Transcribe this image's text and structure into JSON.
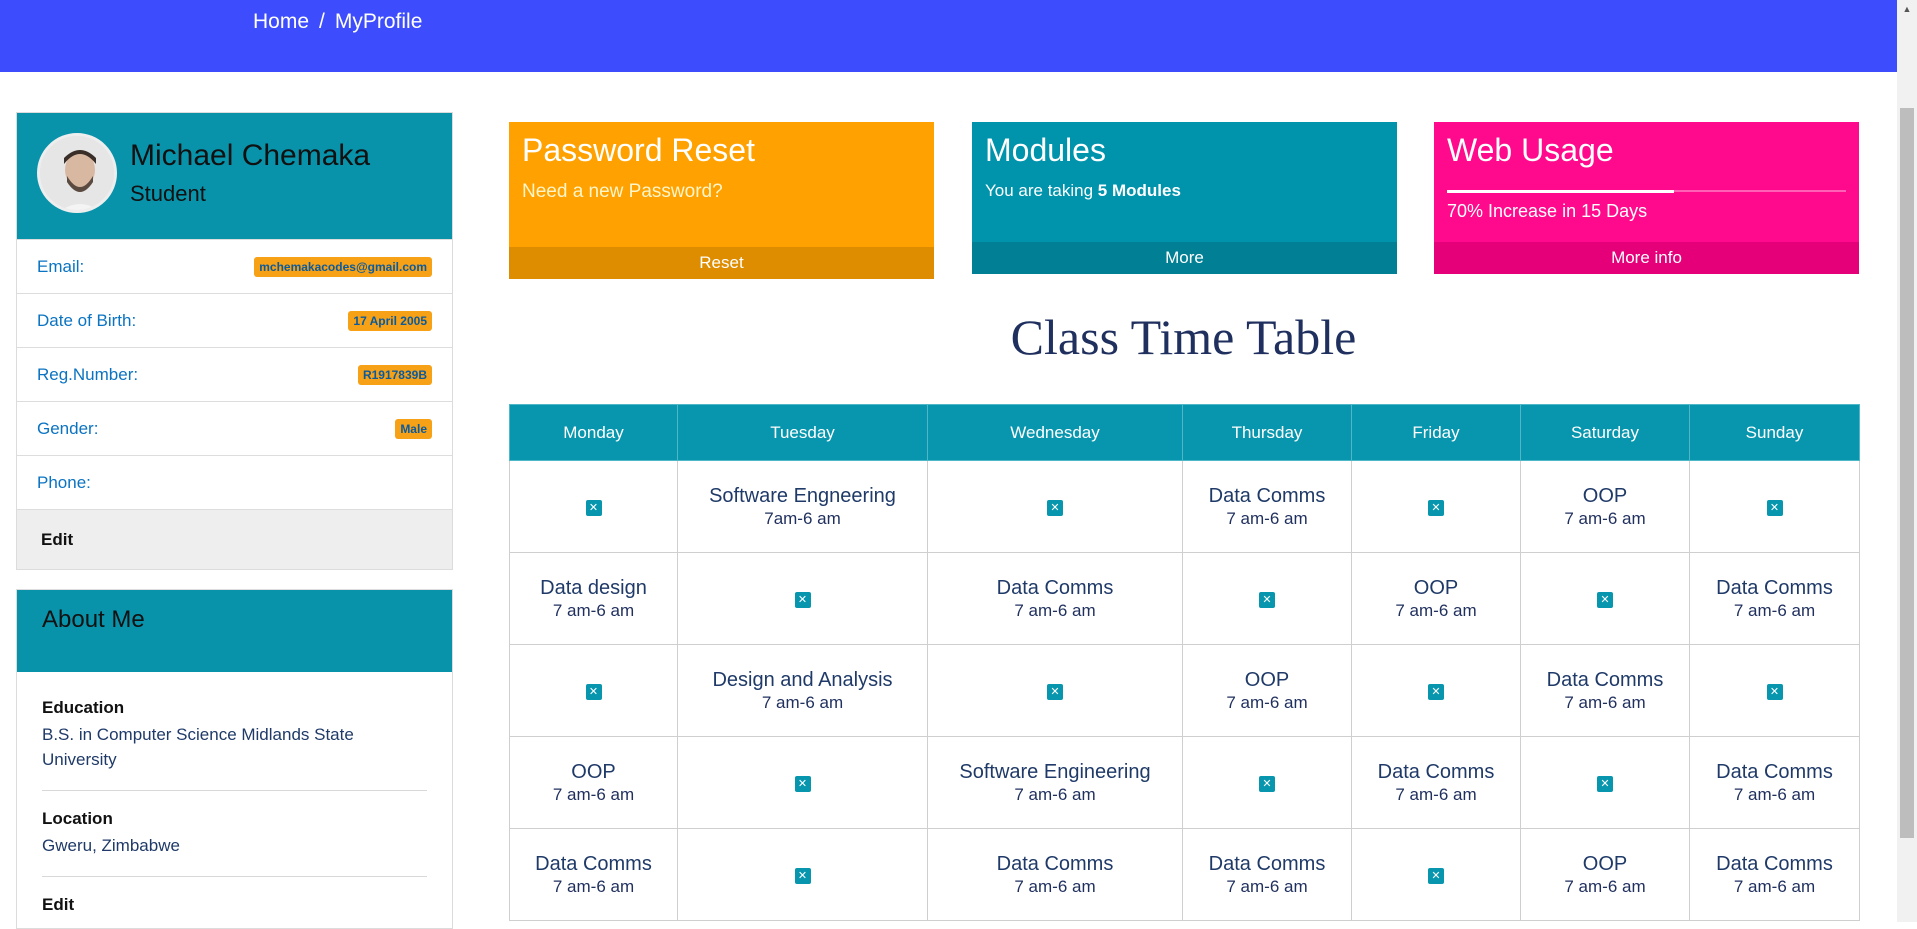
{
  "breadcrumb": {
    "home": "Home",
    "separator": "/",
    "current": "MyProfile"
  },
  "profile": {
    "name": "Michael Chemaka",
    "role": "Student",
    "fields": [
      {
        "label": "Email:",
        "value": "mchemakacodes@gmail.com"
      },
      {
        "label": "Date of Birth:",
        "value": "17 April 2005"
      },
      {
        "label": "Reg.Number:",
        "value": "R1917839B"
      },
      {
        "label": "Gender:",
        "value": "Male"
      },
      {
        "label": "Phone:",
        "value": ""
      }
    ],
    "edit_label": "Edit"
  },
  "about": {
    "title": "About Me",
    "education_title": "Education",
    "education_text": "B.S. in Computer Science Midlands State University",
    "location_title": "Location",
    "location_text": "Gweru, Zimbabwe",
    "edit_label": "Edit"
  },
  "cards": {
    "reset": {
      "title": "Password Reset",
      "text": "Need a new Password?",
      "footer": "Reset"
    },
    "modules": {
      "title": "Modules",
      "text_prefix": "You are taking ",
      "text_bold": "5 Modules",
      "footer": "More"
    },
    "web": {
      "title": "Web Usage",
      "text": "70% Increase in 15 Days",
      "footer": "More info",
      "progress": 0.57
    }
  },
  "timetable": {
    "heading": "Class Time Table",
    "days": [
      "Monday",
      "Tuesday",
      "Wednesday",
      "Thursday",
      "Friday",
      "Saturday",
      "Sunday"
    ],
    "rows": [
      [
        null,
        {
          "s": "Software Engneering",
          "t": "7am-6 am"
        },
        null,
        {
          "s": "Data Comms",
          "t": "7 am-6 am"
        },
        null,
        {
          "s": "OOP",
          "t": "7 am-6 am"
        },
        null
      ],
      [
        {
          "s": "Data design",
          "t": "7 am-6 am"
        },
        null,
        {
          "s": "Data Comms",
          "t": "7 am-6 am"
        },
        null,
        {
          "s": "OOP",
          "t": "7 am-6 am"
        },
        null,
        {
          "s": "Data Comms",
          "t": "7 am-6 am"
        }
      ],
      [
        null,
        {
          "s": "Design and Analysis",
          "t": "7 am-6 am"
        },
        null,
        {
          "s": "OOP",
          "t": "7 am-6 am"
        },
        null,
        {
          "s": "Data Comms",
          "t": "7 am-6 am"
        },
        null
      ],
      [
        {
          "s": "OOP",
          "t": "7 am-6 am"
        },
        null,
        {
          "s": "Software Engineering",
          "t": "7 am-6 am"
        },
        null,
        {
          "s": "Data Comms",
          "t": "7 am-6 am"
        },
        null,
        {
          "s": "Data Comms",
          "t": "7 am-6 am"
        }
      ],
      [
        {
          "s": "Data Comms",
          "t": "7 am-6 am"
        },
        null,
        {
          "s": "Data Comms",
          "t": "7 am-6 am"
        },
        {
          "s": "Data Comms",
          "t": "7 am-6 am"
        },
        null,
        {
          "s": "OOP",
          "t": "7 am-6 am"
        },
        {
          "s": "Data Comms",
          "t": "7 am-6 am"
        }
      ]
    ],
    "empty_icon": "close-icon"
  }
}
